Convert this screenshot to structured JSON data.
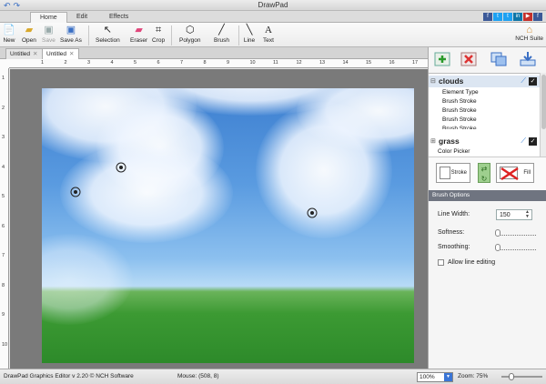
{
  "window": {
    "title": "DrawPad"
  },
  "menu_tabs": [
    {
      "label": "Home",
      "active": true
    },
    {
      "label": "Edit",
      "active": false
    },
    {
      "label": "Effects",
      "active": false
    }
  ],
  "social_icons": [
    "facebook-icon",
    "twitter-icon",
    "twitter-icon",
    "linkedin-icon",
    "youtube-icon",
    "facebook-icon"
  ],
  "toolbar": {
    "new": "New",
    "open": "Open",
    "save": "Save",
    "save_as": "Save As",
    "selection": "Selection",
    "eraser": "Eraser",
    "crop": "Crop",
    "polygon": "Polygon",
    "brush": "Brush",
    "line": "Line",
    "text": "Text",
    "nch_suite": "NCH Suite"
  },
  "doc_tabs": [
    {
      "label": "Untitled",
      "active": false
    },
    {
      "label": "Untitled",
      "active": true
    }
  ],
  "ruler": {
    "horizontal": [
      "1",
      "2",
      "3",
      "4",
      "5",
      "6",
      "7",
      "8",
      "9",
      "10",
      "11",
      "12",
      "13",
      "14",
      "15",
      "16",
      "17",
      "18"
    ],
    "vertical": [
      "1",
      "2",
      "3",
      "4",
      "5",
      "6",
      "7",
      "8",
      "9",
      "10"
    ]
  },
  "elements": [
    {
      "name": "clouds",
      "checked": true,
      "children": [
        "Element Type",
        "Brush Stroke",
        "Brush Stroke",
        "Brush Stroke",
        "Brush Stroke"
      ]
    },
    {
      "name": "grass",
      "checked": true,
      "children": []
    }
  ],
  "color_picker": {
    "label": "Color Picker",
    "stroke_label": "Stroke",
    "fill_label": "Fill"
  },
  "brush_options": {
    "header": "Brush Options",
    "line_width_label": "Line Width:",
    "line_width_value": "150",
    "softness_label": "Softness:",
    "smoothing_label": "Smoothing:",
    "allow_line_editing_label": "Allow line editing",
    "allow_line_editing": false
  },
  "status": {
    "app_info": "DrawPad Graphics Editor v 2.20 © NCH Software",
    "mouse": "Mouse: (508, 8)",
    "zoom_select": "100%",
    "zoom_label": "Zoom: 75%",
    "zoom_fraction": 0.2
  }
}
